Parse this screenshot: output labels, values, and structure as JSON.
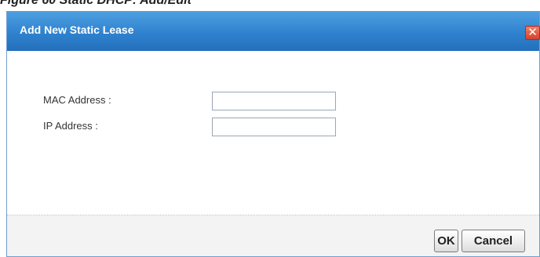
{
  "figure_caption": "Figure 60   Static DHCP: Add/Edit",
  "dialog": {
    "title": "Add New Static Lease",
    "close_symbol": "✕"
  },
  "form": {
    "mac_label": "MAC Address :",
    "mac_value": "",
    "ip_label": "IP Address :",
    "ip_value": ""
  },
  "footer": {
    "ok_label": "OK",
    "cancel_label": "Cancel"
  },
  "colors": {
    "titlebar": "#2f82cf",
    "close_button": "#d6402a"
  }
}
